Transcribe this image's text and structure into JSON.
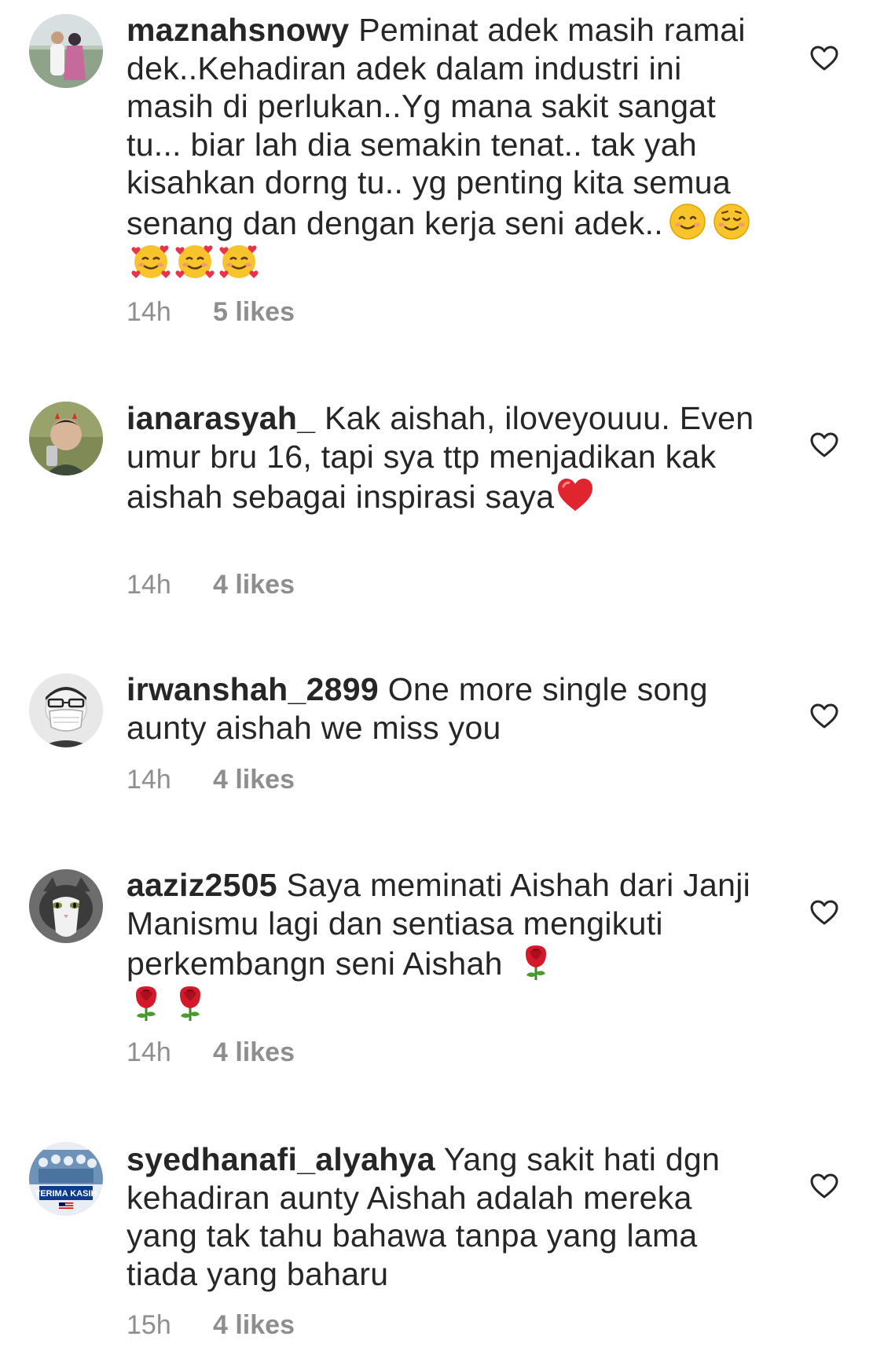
{
  "comments": [
    {
      "username": "maznahsnowy",
      "text": " Peminat adek masih ramai dek..Kehadiran adek dalam industri ini masih di perlukan..Yg mana sakit sangat tu... biar lah dia semakin tenat.. tak yah kisahkan dorng tu.. yg penting kita semua senang dan dengan kerja seni adek..",
      "emojis": [
        "smiling-face-emoji",
        "relaxed-face-emoji",
        "smiling-face-with-hearts-emoji",
        "smiling-face-with-hearts-emoji",
        "smiling-face-with-hearts-emoji"
      ],
      "time": "14h",
      "likes": "5 likes",
      "avatar": "couple-photo-avatar"
    },
    {
      "username": "ianarasyah_",
      "text": " Kak aishah, iloveyouuu. Even umur bru 16, tapi sya ttp menjadikan kak aishah sebagai inspirasi saya",
      "emojis": [
        "red-heart-emoji"
      ],
      "time": "14h",
      "likes": "4 likes",
      "avatar": "selfie-avatar"
    },
    {
      "username": "irwanshah_2899",
      "text": " One more single song aunty aishah we miss you",
      "emojis": [],
      "time": "14h",
      "likes": "4 likes",
      "avatar": "masked-man-avatar"
    },
    {
      "username": "aaziz2505",
      "text": " Saya meminati Aishah dari Janji Manismu lagi dan sentiasa mengikuti perkembangn seni Aishah ",
      "emojis": [
        "rose-emoji",
        "rose-emoji",
        "rose-emoji"
      ],
      "time": "14h",
      "likes": "4 likes",
      "avatar": "cat-avatar"
    },
    {
      "username": "syedhanafi_alyahya",
      "text": " Yang sakit hati dgn kehadiran aunty Aishah adalah mereka yang tak tahu bahawa tanpa yang lama tiada yang baharu",
      "emojis": [],
      "time": "15h",
      "likes": "4 likes",
      "avatar": "terima-kasih-badge-avatar",
      "avatar_text": "TERIMA KASIH"
    }
  ],
  "colors": {
    "text": "#262626",
    "meta": "#8e8e8e",
    "heart_outline": "#262626"
  }
}
